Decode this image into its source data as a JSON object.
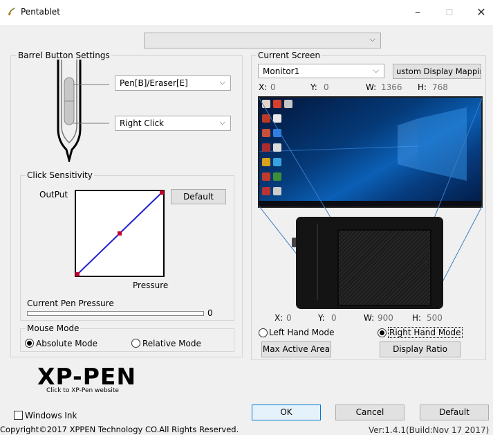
{
  "window": {
    "title": "Pentablet",
    "minimize_label": "–",
    "maximize_label": "☐",
    "close_label": "✕"
  },
  "top_combo": {
    "value": ""
  },
  "barrel": {
    "group_title": "Barrel Button Settings",
    "upper_button": "Pen[B]/Eraser[E]",
    "lower_button": "Right Click"
  },
  "sensitivity": {
    "group_title": "Click Sensitivity",
    "output_label": "OutPut",
    "default_button": "Default",
    "pressure_label": "Pressure",
    "curve_points": [
      [
        0,
        0
      ],
      [
        0.5,
        0.5
      ],
      [
        1,
        1
      ]
    ],
    "current_pen_pressure_label": "Current Pen Pressure",
    "current_pen_pressure_value": "0",
    "current_pen_pressure_fraction": 0
  },
  "mouse_mode": {
    "group_title": "Mouse Mode",
    "absolute_label": "Absolute Mode",
    "relative_label": "Relative Mode",
    "selected": "absolute"
  },
  "logo": {
    "text": "XP-PEN",
    "link_text": "Click to XP-Pen website"
  },
  "current_screen": {
    "group_title": "Current Screen",
    "monitor": "Monitor1",
    "custom_mapping_button": "ustom Display Mappin",
    "x_label": "X:",
    "x_value": "0",
    "y_label": "Y:",
    "y_value": "0",
    "w_label": "W:",
    "w_value": "1366",
    "h_label": "H:",
    "h_value": "768"
  },
  "tablet_area": {
    "x_label": "X:",
    "x_value": "0",
    "y_label": "Y:",
    "y_value": "0",
    "w_label": "W:",
    "w_value": "900",
    "h_label": "H:",
    "h_value": "500",
    "left_hand_label": "Left Hand Mode",
    "right_hand_label": "Right Hand Mode",
    "selected_hand": "right",
    "max_active_area_button": "Max Active Area",
    "display_ratio_button": "Display Ratio"
  },
  "footer": {
    "windows_ink_label": "Windows Ink",
    "windows_ink_checked": false,
    "copyright": "Copyright©2017 XPPEN Technology CO.All Rights Reserved.",
    "ok_button": "OK",
    "cancel_button": "Cancel",
    "default_button": "Default",
    "version": "Ver:1.4.1(Build:Nov 17 2017)"
  },
  "colors": {
    "curve_line": "#2020d0",
    "curve_point": "#c0002c",
    "accent_border": "#0078d7"
  }
}
